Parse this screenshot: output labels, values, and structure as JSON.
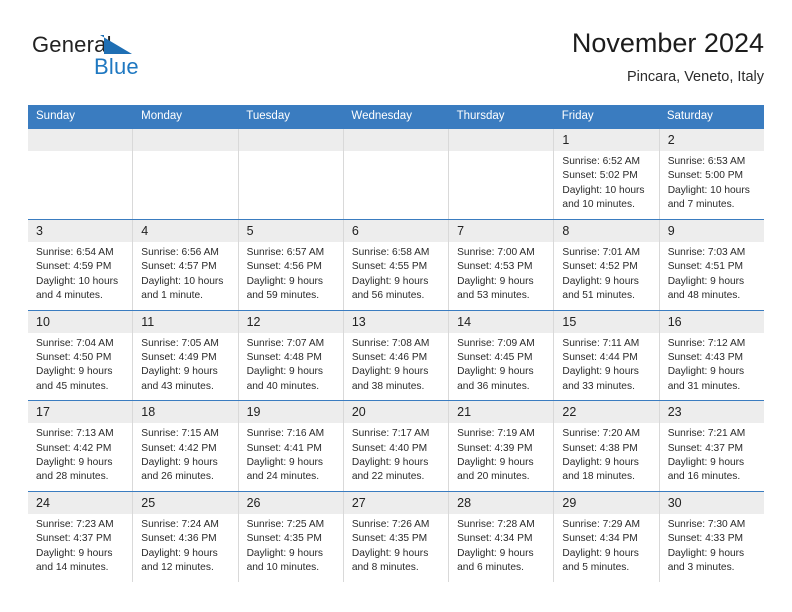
{
  "brand": {
    "name_top": "General",
    "name_bottom": "Blue",
    "accent_color": "#1f78c1",
    "logo_icon": "triangle-icon"
  },
  "header": {
    "title": "November 2024",
    "subtitle": "Pincara, Veneto, Italy"
  },
  "calendar": {
    "header_bg": "#3a7cc0",
    "day_band_bg": "#ededed",
    "weekdays": [
      "Sunday",
      "Monday",
      "Tuesday",
      "Wednesday",
      "Thursday",
      "Friday",
      "Saturday"
    ],
    "weeks": [
      [
        {
          "day": "",
          "sunrise": "",
          "sunset": "",
          "daylight": "",
          "empty": true
        },
        {
          "day": "",
          "sunrise": "",
          "sunset": "",
          "daylight": "",
          "empty": true
        },
        {
          "day": "",
          "sunrise": "",
          "sunset": "",
          "daylight": "",
          "empty": true
        },
        {
          "day": "",
          "sunrise": "",
          "sunset": "",
          "daylight": "",
          "empty": true
        },
        {
          "day": "",
          "sunrise": "",
          "sunset": "",
          "daylight": "",
          "empty": true
        },
        {
          "day": "1",
          "sunrise": "Sunrise: 6:52 AM",
          "sunset": "Sunset: 5:02 PM",
          "daylight": "Daylight: 10 hours and 10 minutes."
        },
        {
          "day": "2",
          "sunrise": "Sunrise: 6:53 AM",
          "sunset": "Sunset: 5:00 PM",
          "daylight": "Daylight: 10 hours and 7 minutes."
        }
      ],
      [
        {
          "day": "3",
          "sunrise": "Sunrise: 6:54 AM",
          "sunset": "Sunset: 4:59 PM",
          "daylight": "Daylight: 10 hours and 4 minutes."
        },
        {
          "day": "4",
          "sunrise": "Sunrise: 6:56 AM",
          "sunset": "Sunset: 4:57 PM",
          "daylight": "Daylight: 10 hours and 1 minute."
        },
        {
          "day": "5",
          "sunrise": "Sunrise: 6:57 AM",
          "sunset": "Sunset: 4:56 PM",
          "daylight": "Daylight: 9 hours and 59 minutes."
        },
        {
          "day": "6",
          "sunrise": "Sunrise: 6:58 AM",
          "sunset": "Sunset: 4:55 PM",
          "daylight": "Daylight: 9 hours and 56 minutes."
        },
        {
          "day": "7",
          "sunrise": "Sunrise: 7:00 AM",
          "sunset": "Sunset: 4:53 PM",
          "daylight": "Daylight: 9 hours and 53 minutes."
        },
        {
          "day": "8",
          "sunrise": "Sunrise: 7:01 AM",
          "sunset": "Sunset: 4:52 PM",
          "daylight": "Daylight: 9 hours and 51 minutes."
        },
        {
          "day": "9",
          "sunrise": "Sunrise: 7:03 AM",
          "sunset": "Sunset: 4:51 PM",
          "daylight": "Daylight: 9 hours and 48 minutes."
        }
      ],
      [
        {
          "day": "10",
          "sunrise": "Sunrise: 7:04 AM",
          "sunset": "Sunset: 4:50 PM",
          "daylight": "Daylight: 9 hours and 45 minutes."
        },
        {
          "day": "11",
          "sunrise": "Sunrise: 7:05 AM",
          "sunset": "Sunset: 4:49 PM",
          "daylight": "Daylight: 9 hours and 43 minutes."
        },
        {
          "day": "12",
          "sunrise": "Sunrise: 7:07 AM",
          "sunset": "Sunset: 4:48 PM",
          "daylight": "Daylight: 9 hours and 40 minutes."
        },
        {
          "day": "13",
          "sunrise": "Sunrise: 7:08 AM",
          "sunset": "Sunset: 4:46 PM",
          "daylight": "Daylight: 9 hours and 38 minutes."
        },
        {
          "day": "14",
          "sunrise": "Sunrise: 7:09 AM",
          "sunset": "Sunset: 4:45 PM",
          "daylight": "Daylight: 9 hours and 36 minutes."
        },
        {
          "day": "15",
          "sunrise": "Sunrise: 7:11 AM",
          "sunset": "Sunset: 4:44 PM",
          "daylight": "Daylight: 9 hours and 33 minutes."
        },
        {
          "day": "16",
          "sunrise": "Sunrise: 7:12 AM",
          "sunset": "Sunset: 4:43 PM",
          "daylight": "Daylight: 9 hours and 31 minutes."
        }
      ],
      [
        {
          "day": "17",
          "sunrise": "Sunrise: 7:13 AM",
          "sunset": "Sunset: 4:42 PM",
          "daylight": "Daylight: 9 hours and 28 minutes."
        },
        {
          "day": "18",
          "sunrise": "Sunrise: 7:15 AM",
          "sunset": "Sunset: 4:42 PM",
          "daylight": "Daylight: 9 hours and 26 minutes."
        },
        {
          "day": "19",
          "sunrise": "Sunrise: 7:16 AM",
          "sunset": "Sunset: 4:41 PM",
          "daylight": "Daylight: 9 hours and 24 minutes."
        },
        {
          "day": "20",
          "sunrise": "Sunrise: 7:17 AM",
          "sunset": "Sunset: 4:40 PM",
          "daylight": "Daylight: 9 hours and 22 minutes."
        },
        {
          "day": "21",
          "sunrise": "Sunrise: 7:19 AM",
          "sunset": "Sunset: 4:39 PM",
          "daylight": "Daylight: 9 hours and 20 minutes."
        },
        {
          "day": "22",
          "sunrise": "Sunrise: 7:20 AM",
          "sunset": "Sunset: 4:38 PM",
          "daylight": "Daylight: 9 hours and 18 minutes."
        },
        {
          "day": "23",
          "sunrise": "Sunrise: 7:21 AM",
          "sunset": "Sunset: 4:37 PM",
          "daylight": "Daylight: 9 hours and 16 minutes."
        }
      ],
      [
        {
          "day": "24",
          "sunrise": "Sunrise: 7:23 AM",
          "sunset": "Sunset: 4:37 PM",
          "daylight": "Daylight: 9 hours and 14 minutes."
        },
        {
          "day": "25",
          "sunrise": "Sunrise: 7:24 AM",
          "sunset": "Sunset: 4:36 PM",
          "daylight": "Daylight: 9 hours and 12 minutes."
        },
        {
          "day": "26",
          "sunrise": "Sunrise: 7:25 AM",
          "sunset": "Sunset: 4:35 PM",
          "daylight": "Daylight: 9 hours and 10 minutes."
        },
        {
          "day": "27",
          "sunrise": "Sunrise: 7:26 AM",
          "sunset": "Sunset: 4:35 PM",
          "daylight": "Daylight: 9 hours and 8 minutes."
        },
        {
          "day": "28",
          "sunrise": "Sunrise: 7:28 AM",
          "sunset": "Sunset: 4:34 PM",
          "daylight": "Daylight: 9 hours and 6 minutes."
        },
        {
          "day": "29",
          "sunrise": "Sunrise: 7:29 AM",
          "sunset": "Sunset: 4:34 PM",
          "daylight": "Daylight: 9 hours and 5 minutes."
        },
        {
          "day": "30",
          "sunrise": "Sunrise: 7:30 AM",
          "sunset": "Sunset: 4:33 PM",
          "daylight": "Daylight: 9 hours and 3 minutes."
        }
      ]
    ]
  }
}
